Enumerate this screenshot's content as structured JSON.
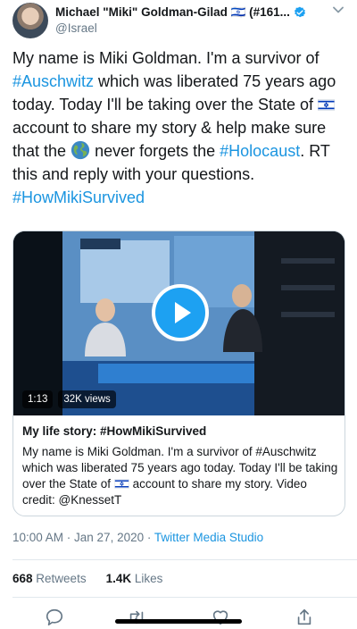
{
  "author": {
    "display_name": "Michael \"Miki\" Goldman-Gilad 🇮🇱 (#161...",
    "handle": "@Israel"
  },
  "tweet": {
    "p1": "My name is Miki Goldman. I'm a survivor of ",
    "tag1": "#Auschwitz",
    "p2": " which was liberated 75 years ago today. Today I'll be taking over the State of ",
    "p3": " account to share my story & help make sure that the ",
    "p4": " never forgets the ",
    "tag2": "#Holocaust",
    "p5": ". RT this and reply with your questions. ",
    "tag3": "#HowMikiSurvived"
  },
  "video": {
    "duration": "1:13",
    "views": "32K views",
    "title": "My life story: #HowMikiSurvived",
    "desc1": "My name is Miki Goldman. I'm a survivor of #Auschwitz which was liberated 75 years ago today. Today I'll be taking over the State of ",
    "desc2": " account to share my story. Video credit: @KnessetT"
  },
  "meta": {
    "time": "10:00 AM · Jan 27, 2020 · ",
    "source": "Twitter Media Studio"
  },
  "stats": {
    "retweets_count": "668",
    "retweets_label": "Retweets",
    "likes_count": "1.4K",
    "likes_label": "Likes"
  },
  "icons": [
    "verified-badge-icon",
    "chevron-down-icon",
    "israel-flag-icon",
    "globe-icon",
    "play-icon",
    "reply-icon",
    "retweet-icon",
    "like-icon",
    "share-icon"
  ],
  "colors": {
    "link": "#1b95e0",
    "accent": "#1da1f2",
    "secondary_text": "#657786"
  }
}
